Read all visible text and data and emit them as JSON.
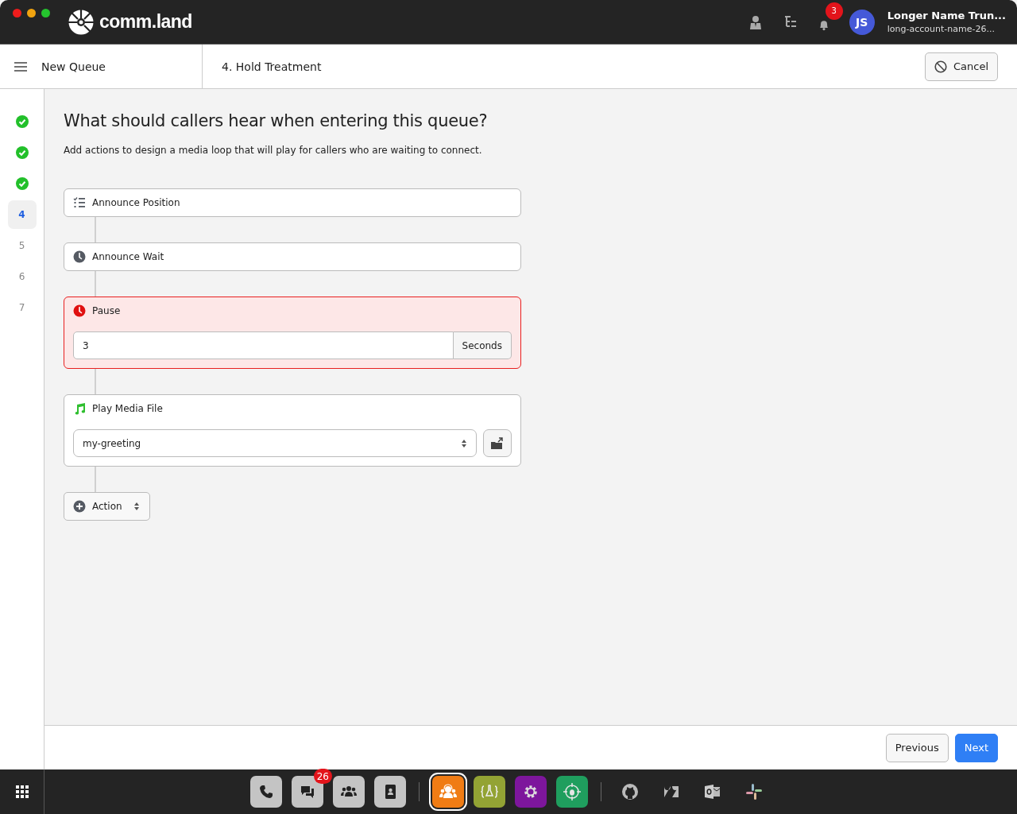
{
  "topbar": {
    "logo": "comm.land",
    "notification_count": "3",
    "user_initials": "JS",
    "user_name": "Longer Name Trun...",
    "account": "long-account-name-26..."
  },
  "header": {
    "title": "New Queue",
    "step_title": "4. Hold Treatment",
    "cancel": "Cancel"
  },
  "steps": [
    {
      "completed": true,
      "selected": false
    },
    {
      "completed": true,
      "selected": false
    },
    {
      "completed": true,
      "selected": false
    },
    {
      "label": "4",
      "completed": false,
      "selected": true
    },
    {
      "label": "5",
      "completed": false,
      "selected": false
    },
    {
      "label": "6",
      "completed": false,
      "selected": false
    },
    {
      "label": "7",
      "completed": false,
      "selected": false
    }
  ],
  "heading": "What should callers hear when entering this queue?",
  "description": "Add actions to design a media loop that will play for callers who are waiting to connect.",
  "actions": [
    {
      "kind": "position",
      "label": "Announce Position",
      "error": false
    },
    {
      "kind": "wait",
      "label": "Announce Wait",
      "error": false
    },
    {
      "kind": "pause",
      "label": "Pause",
      "error": true,
      "value": "3",
      "unit": "Seconds"
    },
    {
      "kind": "media",
      "label": "Play Media File",
      "error": false,
      "value": "my-greeting"
    }
  ],
  "add_action": "Action",
  "footer": {
    "previous": "Previous",
    "next": "Next"
  },
  "dock": [
    {
      "kind": "phone",
      "selected": false
    },
    {
      "kind": "chat",
      "selected": false,
      "badge": "26"
    },
    {
      "kind": "people",
      "selected": false
    },
    {
      "kind": "contacts",
      "selected": false
    },
    {
      "kind": "separator"
    },
    {
      "kind": "queue",
      "selected": true,
      "color": "#f07c14"
    },
    {
      "kind": "lab",
      "selected": false,
      "color": "#93a334"
    },
    {
      "kind": "gear",
      "selected": false,
      "color": "#7d169c"
    },
    {
      "kind": "bug",
      "selected": false,
      "color": "#1f9e5e"
    },
    {
      "kind": "separator"
    },
    {
      "kind": "github",
      "selected": false
    },
    {
      "kind": "zendesk",
      "selected": false
    },
    {
      "kind": "outlook",
      "selected": false
    },
    {
      "kind": "slack",
      "selected": false
    }
  ]
}
